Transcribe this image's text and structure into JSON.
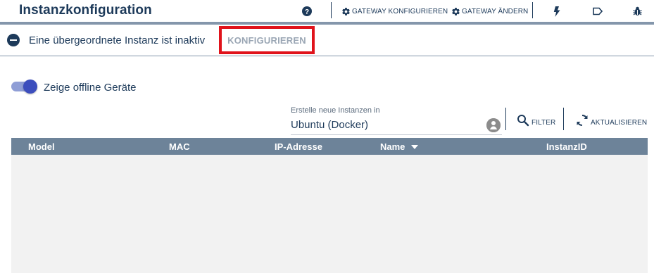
{
  "header": {
    "title": "Instanzkonfiguration",
    "help_icon": "question-circle-icon",
    "configure_gateway_label": "GATEWAY KONFIGURIEREN",
    "change_gateway_label": "GATEWAY ÄNDERN",
    "gear_icon": "gear-icon",
    "flash_icon": "lightning-icon",
    "label_icon": "tag-outline-icon",
    "bug_icon": "bug-icon"
  },
  "banner": {
    "icon": "minus-circle-icon",
    "text": "Eine übergeordnete Instanz ist inaktiv",
    "action_label": "KONFIGURIEREN",
    "highlight_color": "#e0131b"
  },
  "toggle": {
    "label": "Zeige offline Geräte",
    "checked": true,
    "accent_color": "#3c4ebd"
  },
  "instance_select": {
    "label": "Erstelle neue Instanzen in",
    "value": "Ubuntu (Docker)",
    "icon": "server-status-icon"
  },
  "actions": {
    "filter_label": "FILTER",
    "refresh_label": "AKTUALISIEREN",
    "search_icon": "search-icon",
    "refresh_icon": "refresh-icon"
  },
  "table": {
    "columns": [
      "Model",
      "MAC",
      "IP-Adresse",
      "Name",
      "InstanzID"
    ],
    "sorted_column": "Name",
    "sort_icon": "caret-down-icon",
    "rows": [],
    "header_color": "#6d8399"
  }
}
